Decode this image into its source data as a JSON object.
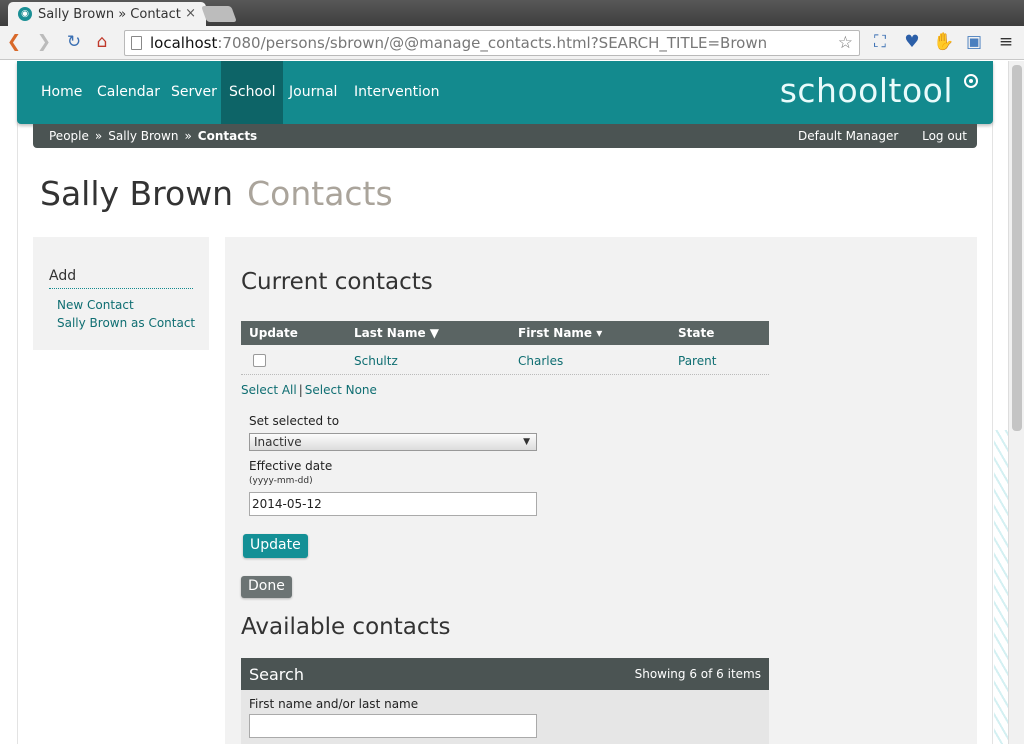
{
  "browser": {
    "tab_title": "Sally Brown » Contact",
    "tab_close": "×",
    "url_host": "localhost",
    "url_rest": ":7080/persons/sbrown/@@manage_contacts.html?SEARCH_TITLE=Brown"
  },
  "nav": {
    "items": [
      "Home",
      "Calendar",
      "Server",
      "School",
      "Journal",
      "Intervention"
    ],
    "active": "School",
    "logo": "schooltool"
  },
  "breadcrumb": {
    "items": [
      "People",
      "Sally Brown"
    ],
    "current": "Contacts",
    "separator": "»"
  },
  "user": {
    "manager": "Default Manager",
    "logout": "Log out"
  },
  "page": {
    "title": "Sally Brown",
    "subtitle": "Contacts"
  },
  "sidebar": {
    "heading": "Add",
    "links": [
      "New Contact",
      "Sally Brown as Contact"
    ]
  },
  "current": {
    "heading": "Current contacts",
    "columns": [
      "Update",
      "Last Name ▼",
      "First Name ▾",
      "State"
    ],
    "rows": [
      {
        "checked": false,
        "last": "Schultz",
        "first": "Charles",
        "state": "Parent"
      }
    ],
    "select_all": "Select All",
    "select_none": "Select None",
    "divider": "|",
    "set_label": "Set selected to",
    "set_value": "Inactive",
    "date_label": "Effective date",
    "date_hint": "(yyyy-mm-dd)",
    "date_value": "2014-05-12",
    "update_button": "Update",
    "done_button": "Done"
  },
  "available": {
    "heading": "Available contacts",
    "search_title": "Search",
    "count": "Showing 6 of 6 items",
    "field_label": "First name and/or last name",
    "field_value": ""
  },
  "colors": {
    "accent": "#138a8e",
    "active_nav": "#0d6467",
    "breadcrumb_bg": "#4b5453",
    "link": "#0f6e72"
  }
}
